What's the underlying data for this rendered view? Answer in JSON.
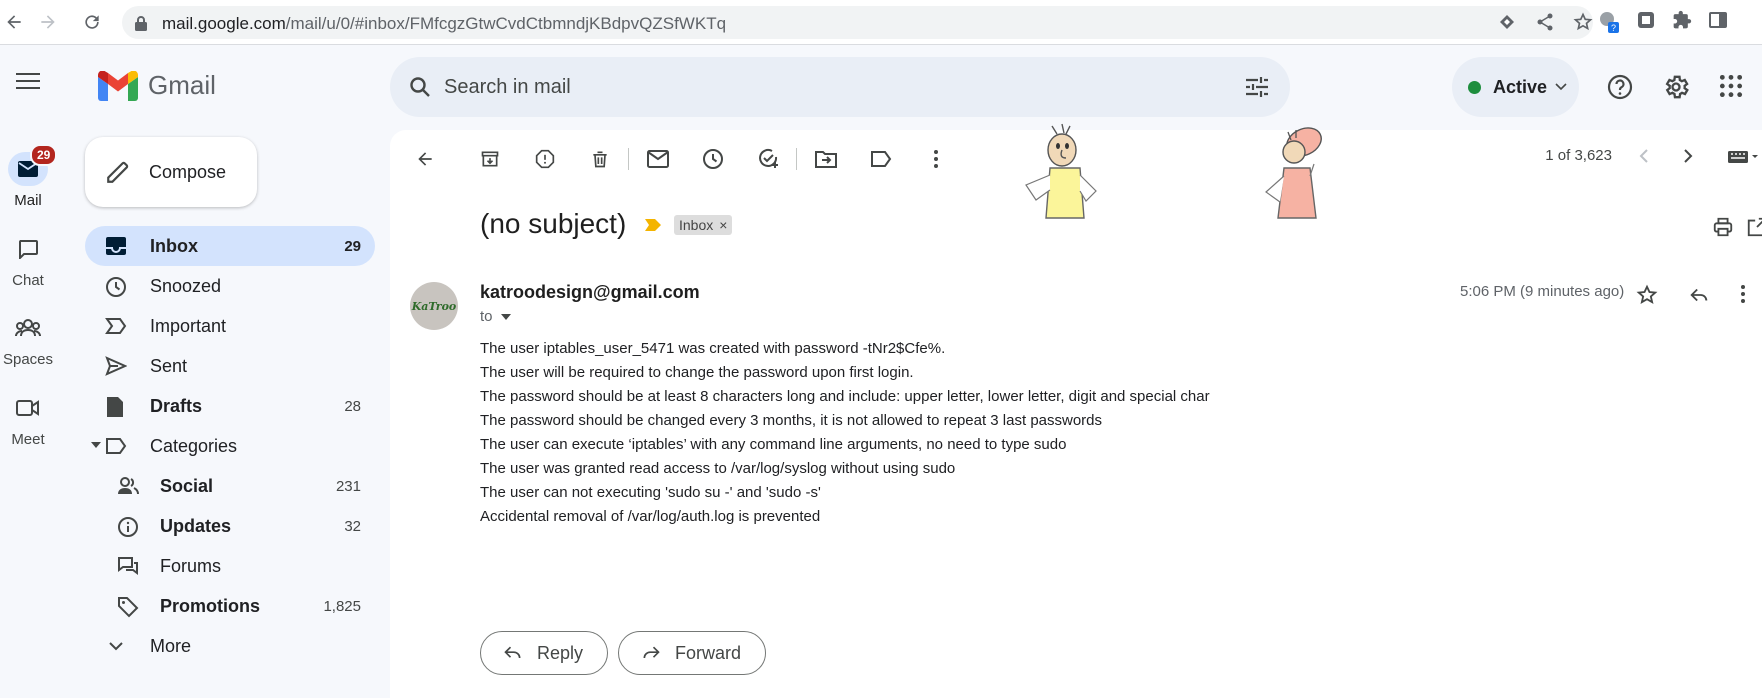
{
  "browser": {
    "url_host": "mail.google.com",
    "url_path": "/mail/u/0/#inbox/FMfcgzGtwCvdCtbmndjKBdpvQZSfWKTq"
  },
  "app": {
    "name": "Gmail",
    "search_placeholder": "Search in mail",
    "status": "Active",
    "status_color": "#1e8e3e",
    "accent": "#d3e3fd"
  },
  "rail": {
    "items": [
      {
        "label": "Mail",
        "icon": "mail-icon",
        "badge": "29"
      },
      {
        "label": "Chat",
        "icon": "chat-icon"
      },
      {
        "label": "Spaces",
        "icon": "spaces-icon"
      },
      {
        "label": "Meet",
        "icon": "meet-icon"
      }
    ]
  },
  "compose_label": "Compose",
  "nav": {
    "items": [
      {
        "label": "Inbox",
        "count": "29",
        "icon": "inbox-icon"
      },
      {
        "label": "Snoozed",
        "count": "",
        "icon": "clock-icon"
      },
      {
        "label": "Important",
        "count": "",
        "icon": "important-icon"
      },
      {
        "label": "Sent",
        "count": "",
        "icon": "send-icon"
      },
      {
        "label": "Drafts",
        "count": "28",
        "icon": "draft-icon"
      },
      {
        "label": "Categories",
        "count": "",
        "icon": "label-icon"
      },
      {
        "label": "Social",
        "count": "231",
        "icon": "people-icon"
      },
      {
        "label": "Updates",
        "count": "32",
        "icon": "info-icon"
      },
      {
        "label": "Forums",
        "count": "",
        "icon": "forum-icon"
      },
      {
        "label": "Promotions",
        "count": "1,825",
        "icon": "tag-icon"
      },
      {
        "label": "More",
        "count": "",
        "icon": "chevron-down-icon"
      }
    ]
  },
  "pager": {
    "text": "1 of 3,623"
  },
  "email": {
    "subject": "(no subject)",
    "label_chip": "Inbox",
    "label_chip_close": "×",
    "sender": "katroodesign@gmail.com",
    "avatar_text": "KaTroo",
    "to": "to",
    "timestamp": "5:06 PM (9 minutes ago)",
    "body_lines": [
      "The user iptables_user_5471 was created with password -tNr2$Cfe%.",
      "The user will be required to change the password upon first login.",
      "The password should be at least 8 characters long and include: upper letter, lower letter, digit and special char",
      "The password should be changed every 3 months, it is not allowed to repeat 3 last passwords",
      "The user can execute ‘iptables’ with any command line arguments, no need to type sudo",
      "The user was granted read access to /var/log/syslog without using sudo",
      "The user can not executing 'sudo su -' and 'sudo -s'",
      "Accidental removal of /var/log/auth.log is prevented"
    ]
  },
  "actions": {
    "reply": "Reply",
    "forward": "Forward"
  }
}
